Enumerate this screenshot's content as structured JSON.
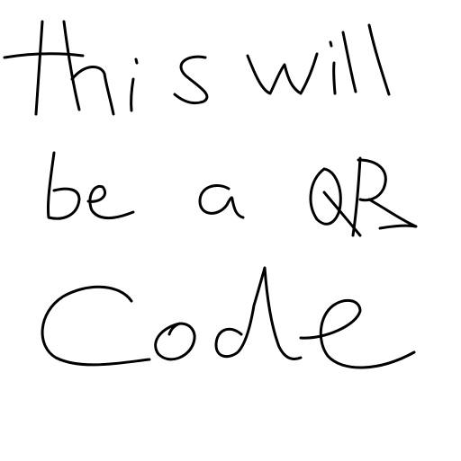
{
  "handwriting": {
    "line1": "this will",
    "line2": "be a QR",
    "line3": "Code"
  },
  "colors": {
    "background": "#ffffff",
    "ink": "#000000"
  }
}
